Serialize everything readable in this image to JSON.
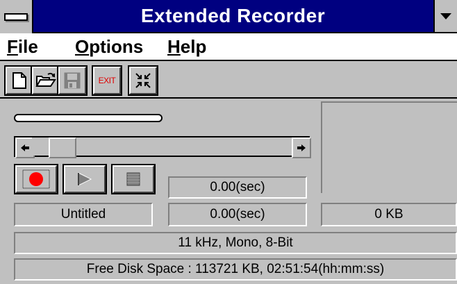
{
  "window": {
    "title": "Extended Recorder",
    "system_menu_icon": "system-menu-bar",
    "dropdown_icon": "down-triangle"
  },
  "menu": {
    "items": [
      {
        "accel": "F",
        "rest": "ile"
      },
      {
        "accel": "O",
        "rest": "ptions"
      },
      {
        "accel": "H",
        "rest": "elp"
      }
    ]
  },
  "toolbar": {
    "new_icon": "new-document-icon",
    "open_icon": "open-folder-icon",
    "save_icon": "save-disk-icon",
    "exit_label": "EXIT",
    "compact_icon": "collapse-arrows-icon"
  },
  "transport": {
    "record_icon": "record-icon",
    "play_icon": "play-icon",
    "stop_icon": "stop-icon",
    "scroll_position": 0
  },
  "status": {
    "elapsed": "0.00(sec)",
    "filename": "Untitled",
    "duration": "0.00(sec)",
    "filesize": "0 KB",
    "format": "11 kHz, Mono, 8-Bit",
    "free_space": "Free Disk Space : 113721 KB, 02:51:54(hh:mm:ss)"
  },
  "colors": {
    "titlebar": "#000080",
    "face": "#c0c0c0",
    "record_red": "#ff0000",
    "exit_red": "#e00000"
  }
}
